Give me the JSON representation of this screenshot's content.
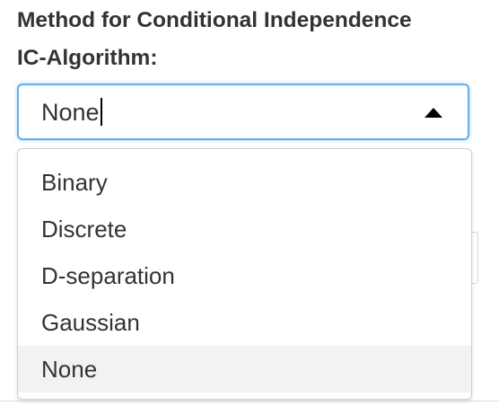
{
  "field": {
    "label_line1": "Method for Conditional Independence",
    "label_line2": "IC-Algorithm:"
  },
  "select": {
    "current_value": "None",
    "open": true
  },
  "dropdown": {
    "options": [
      "Binary",
      "Discrete",
      "D-separation",
      "Gaussian",
      "None"
    ],
    "highlighted": "None"
  },
  "colors": {
    "focus_border": "#66afe9",
    "highlight_bg": "#f2f2f2",
    "text": "#333333"
  },
  "icons": {
    "dropdown_caret": "caret-up-icon"
  }
}
